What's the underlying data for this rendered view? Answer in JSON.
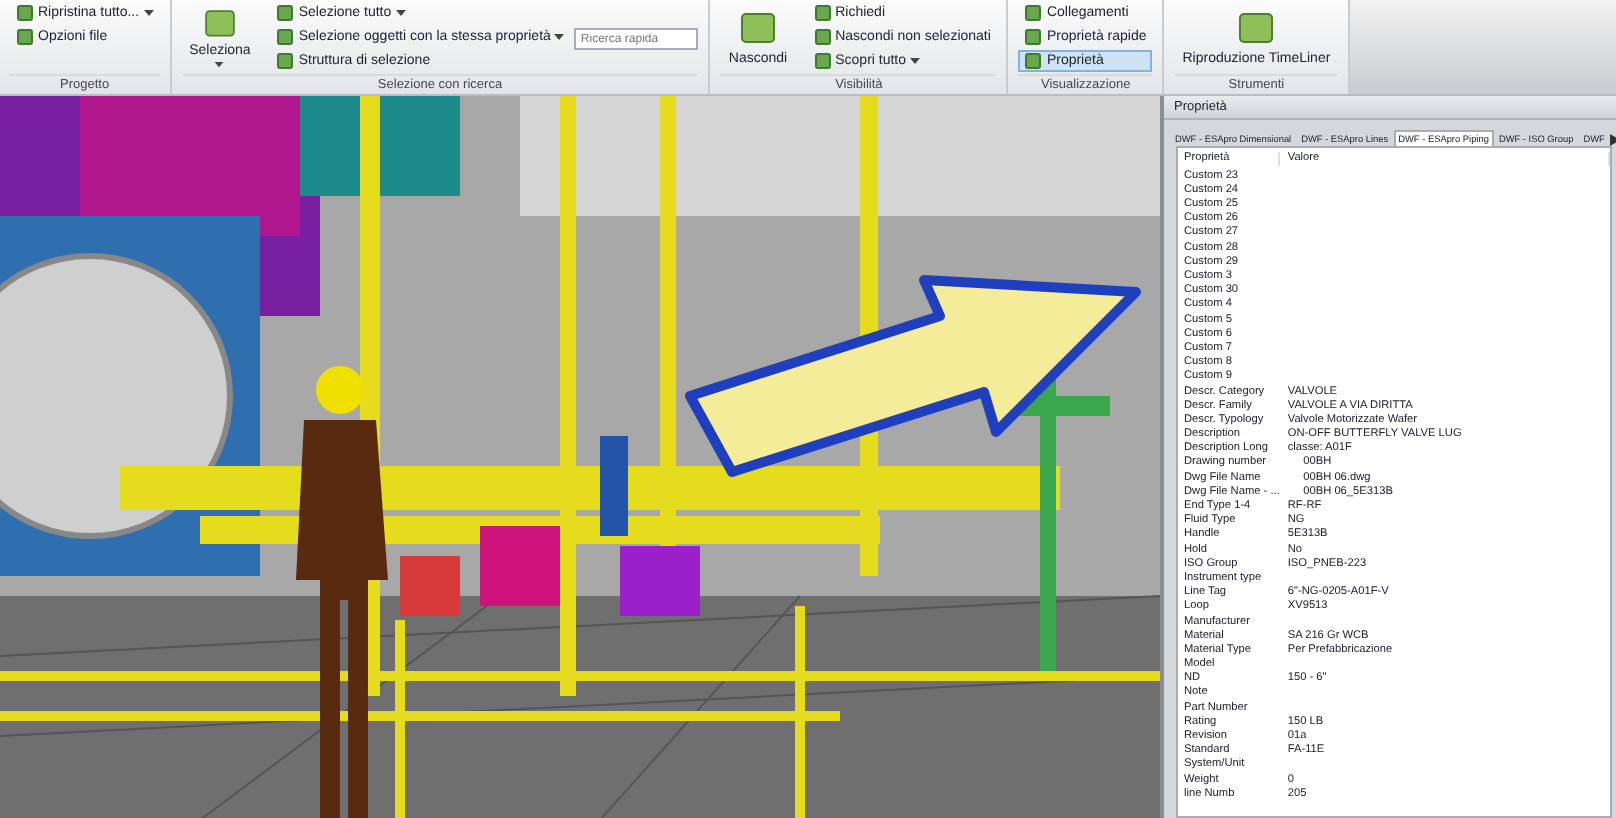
{
  "ribbon": {
    "groups": [
      {
        "label": "Progetto",
        "items": [
          {
            "kind": "small",
            "label": "Ripristina tutto...",
            "dropdown": true,
            "selected": false
          },
          {
            "kind": "small",
            "label": "Opzioni file",
            "dropdown": false,
            "selected": false
          }
        ]
      },
      {
        "label": "Selezione con ricerca",
        "items": [
          {
            "kind": "large",
            "label": "Seleziona",
            "dropdown": true,
            "selected": false
          },
          {
            "kind": "small",
            "label": "Selezione tutto",
            "dropdown": true,
            "selected": false
          },
          {
            "kind": "small",
            "label": "Selezione oggetti con la stessa proprietà",
            "dropdown": true,
            "selected": false
          },
          {
            "kind": "small",
            "label": "Struttura di selezione",
            "dropdown": false,
            "selected": false
          },
          {
            "kind": "search",
            "placeholder": "Ricerca rapida"
          }
        ]
      },
      {
        "label": "Visibilità",
        "items": [
          {
            "kind": "large",
            "label": "Nascondi",
            "dropdown": false,
            "selected": false
          },
          {
            "kind": "small",
            "label": "Richiedi",
            "dropdown": false,
            "selected": false
          },
          {
            "kind": "small",
            "label": "Nascondi non selezionati",
            "dropdown": false,
            "selected": false
          },
          {
            "kind": "small",
            "label": "Scopri tutto",
            "dropdown": true,
            "selected": false
          }
        ]
      },
      {
        "label": "Visualizzazione",
        "items": [
          {
            "kind": "small",
            "label": "Collegamenti",
            "dropdown": false,
            "selected": false
          },
          {
            "kind": "small",
            "label": "Proprietà rapide",
            "dropdown": false,
            "selected": false
          },
          {
            "kind": "small",
            "label": "Proprietà",
            "dropdown": false,
            "selected": true
          }
        ]
      },
      {
        "label": "Strumenti",
        "items": [
          {
            "kind": "large",
            "label": "Riproduzione TimeLiner",
            "dropdown": false,
            "selected": false
          }
        ]
      }
    ]
  },
  "properties": {
    "title": "Proprietà",
    "tabs": [
      {
        "label": "DWF - ESApro Dimensional",
        "selected": false
      },
      {
        "label": "DWF - ESApro Lines",
        "selected": false
      },
      {
        "label": "DWF - ESApro Piping",
        "selected": true
      },
      {
        "label": "DWF - ISO Group",
        "selected": false
      },
      {
        "label": "DWF",
        "selected": false
      }
    ],
    "columns": [
      "Proprietà",
      "Valore"
    ],
    "rows": [
      {
        "name": "Custom 23",
        "value": ""
      },
      {
        "name": "Custom 24",
        "value": ""
      },
      {
        "name": "Custom 25",
        "value": ""
      },
      {
        "name": "Custom 26",
        "value": ""
      },
      {
        "name": "Custom 27",
        "value": ""
      },
      {
        "name": "Custom 28",
        "value": ""
      },
      {
        "name": "Custom 29",
        "value": ""
      },
      {
        "name": "Custom 3",
        "value": ""
      },
      {
        "name": "Custom 30",
        "value": ""
      },
      {
        "name": "Custom 4",
        "value": ""
      },
      {
        "name": "Custom 5",
        "value": ""
      },
      {
        "name": "Custom 6",
        "value": ""
      },
      {
        "name": "Custom 7",
        "value": ""
      },
      {
        "name": "Custom 8",
        "value": ""
      },
      {
        "name": "Custom 9",
        "value": ""
      },
      {
        "name": "Descr. Category",
        "value": "VALVOLE"
      },
      {
        "name": "Descr. Family",
        "value": "VALVOLE A VIA DIRITTA"
      },
      {
        "name": "Descr. Typology",
        "value": "Valvole Motorizzate Wafer"
      },
      {
        "name": "Description",
        "value": "ON-OFF BUTTERFLY VALVE LUG"
      },
      {
        "name": "Description Long",
        "value": "classe: A01F"
      },
      {
        "name": "Drawing number",
        "value": "     00BH"
      },
      {
        "name": "Dwg File Name",
        "value": "     00BH 06.dwg"
      },
      {
        "name": "Dwg File Name - ...",
        "value": "     00BH 06_5E313B"
      },
      {
        "name": "End Type 1-4",
        "value": "RF-RF"
      },
      {
        "name": "Fluid Type",
        "value": "NG"
      },
      {
        "name": "Handle",
        "value": "5E313B"
      },
      {
        "name": "Hold",
        "value": "No"
      },
      {
        "name": "ISO Group",
        "value": "ISO_PNEB-223"
      },
      {
        "name": "Instrument type",
        "value": ""
      },
      {
        "name": "Line Tag",
        "value": "6\"-NG-0205-A01F-V"
      },
      {
        "name": "Loop",
        "value": "XV9513"
      },
      {
        "name": "Manufacturer",
        "value": ""
      },
      {
        "name": "Material",
        "value": "SA 216 Gr WCB"
      },
      {
        "name": "Material Type",
        "value": "Per Prefabbricazione"
      },
      {
        "name": "Model",
        "value": ""
      },
      {
        "name": "ND",
        "value": "150 - 6\""
      },
      {
        "name": "Note",
        "value": ""
      },
      {
        "name": "Part Number",
        "value": ""
      },
      {
        "name": "Rating",
        "value": "150 LB"
      },
      {
        "name": "Revision",
        "value": "01a"
      },
      {
        "name": "Standard",
        "value": "FA-11E"
      },
      {
        "name": "System/Unit",
        "value": ""
      },
      {
        "name": "Weight",
        "value": "0"
      },
      {
        "name": "line Numb",
        "value": "205"
      }
    ]
  }
}
